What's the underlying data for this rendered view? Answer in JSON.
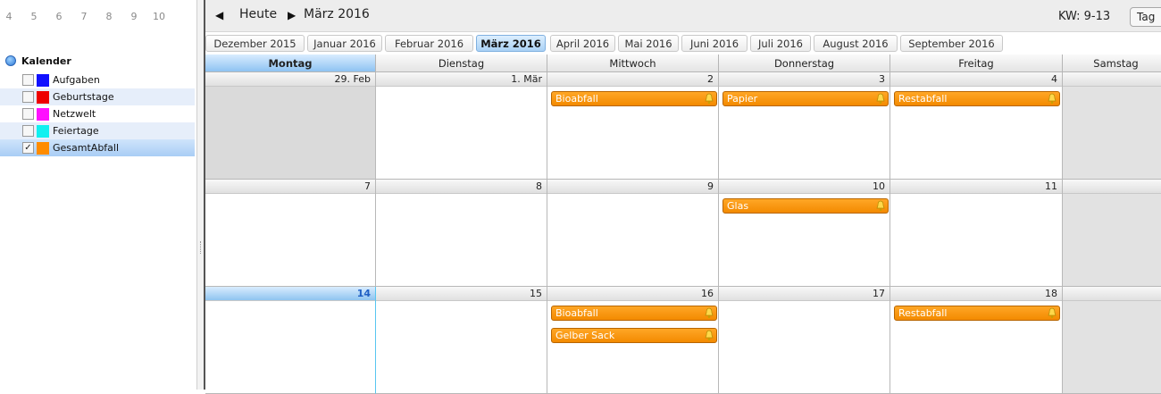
{
  "mini_calendar": {
    "days": [
      "4",
      "5",
      "6",
      "7",
      "8",
      "9",
      "10"
    ]
  },
  "calendars": {
    "header": "Kalender",
    "items": [
      {
        "label": "Aufgaben",
        "color": "#1010ff",
        "checked": false,
        "check_mark": ""
      },
      {
        "label": "Geburtstage",
        "color": "#ee0000",
        "checked": false,
        "check_mark": ""
      },
      {
        "label": "Netzwelt",
        "color": "#ff10ff",
        "checked": false,
        "check_mark": ""
      },
      {
        "label": "Feiertage",
        "color": "#10f0f0",
        "checked": false,
        "check_mark": ""
      },
      {
        "label": "GesamtAbfall",
        "color": "#ff8c00",
        "checked": true,
        "check_mark": "✓"
      }
    ]
  },
  "toolbar": {
    "prev_glyph": "◀",
    "today_label": "Heute",
    "next_glyph": "▶",
    "month_title": "März 2016",
    "week_label": "KW: 9-13",
    "view_button": "Tag"
  },
  "month_tabs": [
    "Dezember 2015",
    "Januar 2016",
    "Februar 2016",
    "März 2016",
    "April 2016",
    "Mai 2016",
    "Juni 2016",
    "Juli 2016",
    "August 2016",
    "September 2016"
  ],
  "active_month": "März 2016",
  "weekdays": [
    "Montag",
    "Dienstag",
    "Mittwoch",
    "Donnerstag",
    "Freitag",
    "Samstag"
  ],
  "weeks": [
    {
      "days": [
        "29. Feb",
        "1. Mär",
        "2",
        "3",
        "4",
        ""
      ]
    },
    {
      "days": [
        "7",
        "8",
        "9",
        "10",
        "11",
        ""
      ]
    },
    {
      "days": [
        "14",
        "15",
        "16",
        "17",
        "18",
        ""
      ]
    }
  ],
  "events": [
    {
      "week": 0,
      "day": 2,
      "slot": 0,
      "title": "Bioabfall"
    },
    {
      "week": 0,
      "day": 3,
      "slot": 0,
      "title": "Papier"
    },
    {
      "week": 0,
      "day": 4,
      "slot": 0,
      "title": "Restabfall"
    },
    {
      "week": 1,
      "day": 3,
      "slot": 0,
      "title": "Glas"
    },
    {
      "week": 2,
      "day": 2,
      "slot": 0,
      "title": "Bioabfall"
    },
    {
      "week": 2,
      "day": 2,
      "slot": 1,
      "title": "Gelber Sack"
    },
    {
      "week": 2,
      "day": 4,
      "slot": 0,
      "title": "Restabfall"
    }
  ],
  "colors": {
    "event_fill": "#f38a00",
    "today_highlight": "#8ec3f2",
    "weekend_fill": "#e2e2e2"
  }
}
